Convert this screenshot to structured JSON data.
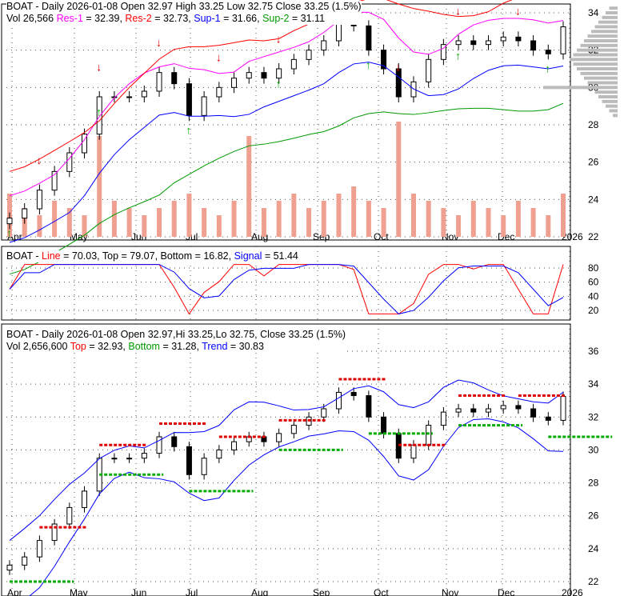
{
  "panel1": {
    "line1": "BOAT - Daily 2026-01-08 Open 32.97  High 33.25  Low 32.75  Close 33.25 (1.5%)",
    "vol": "Vol 26,566",
    "res1": "Res-1",
    "res1_val": " = 32.39, ",
    "res2": "Res-2",
    "res2_val": " = 32.73, ",
    "sup1": "Sup-1",
    "sup1_val": " = 31.66, ",
    "sup2": "Sup-2",
    "sup2_val": " = 31.11"
  },
  "panel2": {
    "prefix": "BOAT - ",
    "line": "Line",
    "line_val": " = 70.03, Top = 79.07, Bottom = 16.82, ",
    "signal": "Signal",
    "signal_val": " = 51.44"
  },
  "panel3": {
    "line1": "BOAT - Daily 2026-01-08 Open 32.97,Hi 33.25,Lo 32.75, Close 33.25 (1.5%)",
    "vol": "Vol 2,656,600 ",
    "top": "Top",
    "top_val": " = 32.93, ",
    "bottom": "Bottom",
    "bottom_val": " = 31.28, ",
    "trend": "Trend",
    "trend_val": " = 30.83"
  },
  "colors": {
    "res1": "#ff00ff",
    "res2": "#ff0000",
    "sup1": "#0000ff",
    "sup2": "#009900",
    "up": "#00aa00",
    "down": "#dd0000"
  },
  "chart_data": {
    "type": "candlestick",
    "x_labels": [
      "Apr",
      "May",
      "Jun",
      "Jul",
      "Aug",
      "Sep",
      "Oct",
      "Nov",
      "Dec",
      "2026"
    ],
    "price_ylim": [
      22,
      34.5
    ],
    "price_ticks": [
      22,
      24,
      26,
      28,
      30,
      32,
      34
    ],
    "osc_ticks": [
      20,
      40,
      60,
      80
    ],
    "p3_ylim": [
      22,
      37
    ],
    "p3_ticks": [
      22,
      24,
      26,
      28,
      30,
      32,
      34,
      36
    ],
    "weekly_close": [
      23,
      23.5,
      24.5,
      25.5,
      26.5,
      27.5,
      29.5,
      29.5,
      29.5,
      29.8,
      30.8,
      30.2,
      28.5,
      29.5,
      30,
      30.5,
      30.8,
      30.5,
      31,
      31.5,
      32,
      32.5,
      33.5,
      33.3,
      32,
      31,
      29.5,
      30.3,
      31.5,
      32.3,
      32.5,
      32.3,
      32.5,
      32.7,
      32.5,
      32,
      31.8,
      33.25
    ],
    "weekly_volume": [
      6,
      4,
      3,
      5,
      4,
      3,
      14,
      5,
      4,
      3,
      4,
      5,
      6,
      4,
      3,
      5,
      14,
      4,
      5,
      6,
      4,
      5,
      6,
      7,
      5,
      4,
      16,
      6,
      5,
      4,
      3,
      5,
      4,
      3,
      5,
      4,
      3,
      6
    ]
  }
}
